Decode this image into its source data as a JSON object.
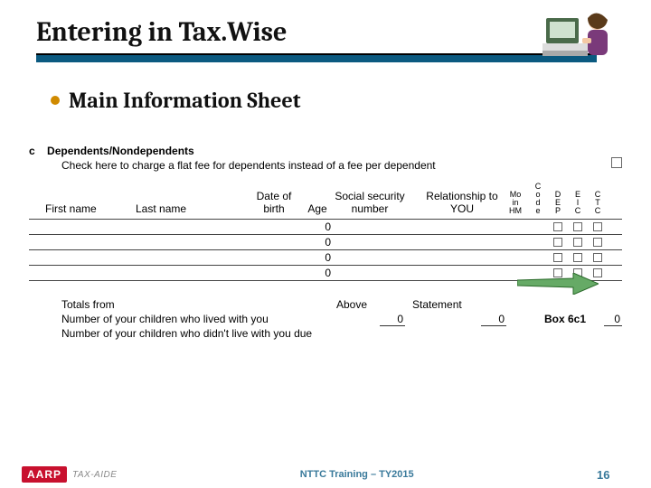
{
  "slide": {
    "title": "Entering in Tax.Wise",
    "bullet": "Main Information Sheet"
  },
  "form": {
    "section_letter": "c",
    "section_label": "Dependents/Nondependents",
    "section_sub": "Check here to charge a flat fee for dependents instead of a fee per dependent",
    "headers": {
      "first": "First name",
      "last": "Last name",
      "dob": "Date of birth",
      "age": "Age",
      "ssn": "Social security number",
      "rel": "Relationship to YOU",
      "mo_line1": "Mo",
      "mo_line2": "in",
      "mo_line3": "HM",
      "cod_line1": "C",
      "cod_line2": "o",
      "cod_line3": "d",
      "cod_line4": "e",
      "dep_line1": "D",
      "dep_line2": "E",
      "dep_line3": "P",
      "eic_line1": "E",
      "eic_line2": "I",
      "eic_line3": "C",
      "ctc_line1": "C",
      "ctc_line2": "T",
      "ctc_line3": "C"
    },
    "rows": [
      {
        "age": "0"
      },
      {
        "age": "0"
      },
      {
        "age": "0"
      },
      {
        "age": "0"
      }
    ],
    "totals": {
      "line1_label": "Totals from",
      "line2_label": "Number of your children who lived with you",
      "line3_label": "Number of your children who didn't live with you due",
      "above_label": "Above",
      "statement_label": "Statement",
      "box_label": "Box 6c1",
      "above_value": "0",
      "statement_value": "0",
      "box_value": "0"
    }
  },
  "footer": {
    "aarp_brand": "AARP",
    "taxaide": "TAX-AIDE",
    "center": "NTTC Training – TY2015",
    "page": "16"
  },
  "colors": {
    "accent_bar": "#0b5a80",
    "bullet": "#d08a00",
    "footer_text": "#3a7a9b",
    "aarp_red": "#c8102e",
    "arrow": "#66aa66"
  }
}
